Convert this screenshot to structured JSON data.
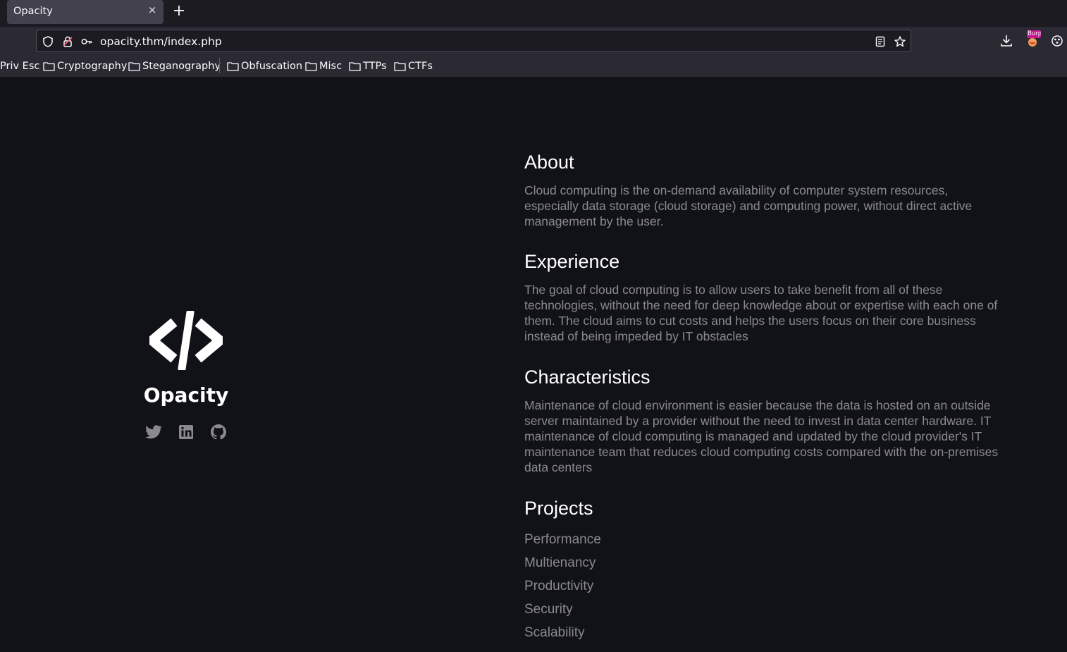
{
  "browser": {
    "tab": {
      "title": "Opacity",
      "close": "×"
    },
    "new_tab": "+",
    "url": "opacity.thm/index.php",
    "bookmarks": [
      {
        "label": "Priv Esc",
        "folder": false
      },
      {
        "label": "Cryptography",
        "folder": true
      },
      {
        "label": "Steganography",
        "folder": true
      },
      {
        "label": "Obfuscation",
        "folder": true
      },
      {
        "label": "Misc",
        "folder": true
      },
      {
        "label": "TTPs",
        "folder": true
      },
      {
        "label": "CTFs",
        "folder": true
      }
    ],
    "extension_badge": "Burp"
  },
  "profile": {
    "name": "Opacity",
    "logo_icon": "code-icon",
    "socials": [
      "twitter-icon",
      "linkedin-icon",
      "github-icon"
    ]
  },
  "sections": {
    "about": {
      "heading": "About",
      "text": "Cloud computing is the on-demand availability of computer system resources, especially data storage (cloud storage) and computing power, without direct active management by the user."
    },
    "experience": {
      "heading": "Experience",
      "text": "The goal of cloud computing is to allow users to take benefit from all of these technologies, without the need for deep knowledge about or expertise with each one of them. The cloud aims to cut costs and helps the users focus on their core business instead of being impeded by IT obstacles"
    },
    "characteristics": {
      "heading": "Characteristics",
      "text": "Maintenance of cloud environment is easier because the data is hosted on an outside server maintained by a provider without the need to invest in data center hardware. IT maintenance of cloud computing is managed and updated by the cloud provider's IT maintenance team that reduces cloud computing costs compared with the on-premises data centers"
    },
    "projects": {
      "heading": "Projects",
      "items": [
        "Performance",
        "Multienancy",
        "Productivity",
        "Security",
        "Scalability"
      ]
    }
  },
  "colors": {
    "page_bg": "#111217",
    "heading": "#ffffff",
    "body_text": "#8a8a8e",
    "chrome_bg": "#2b2a33"
  }
}
